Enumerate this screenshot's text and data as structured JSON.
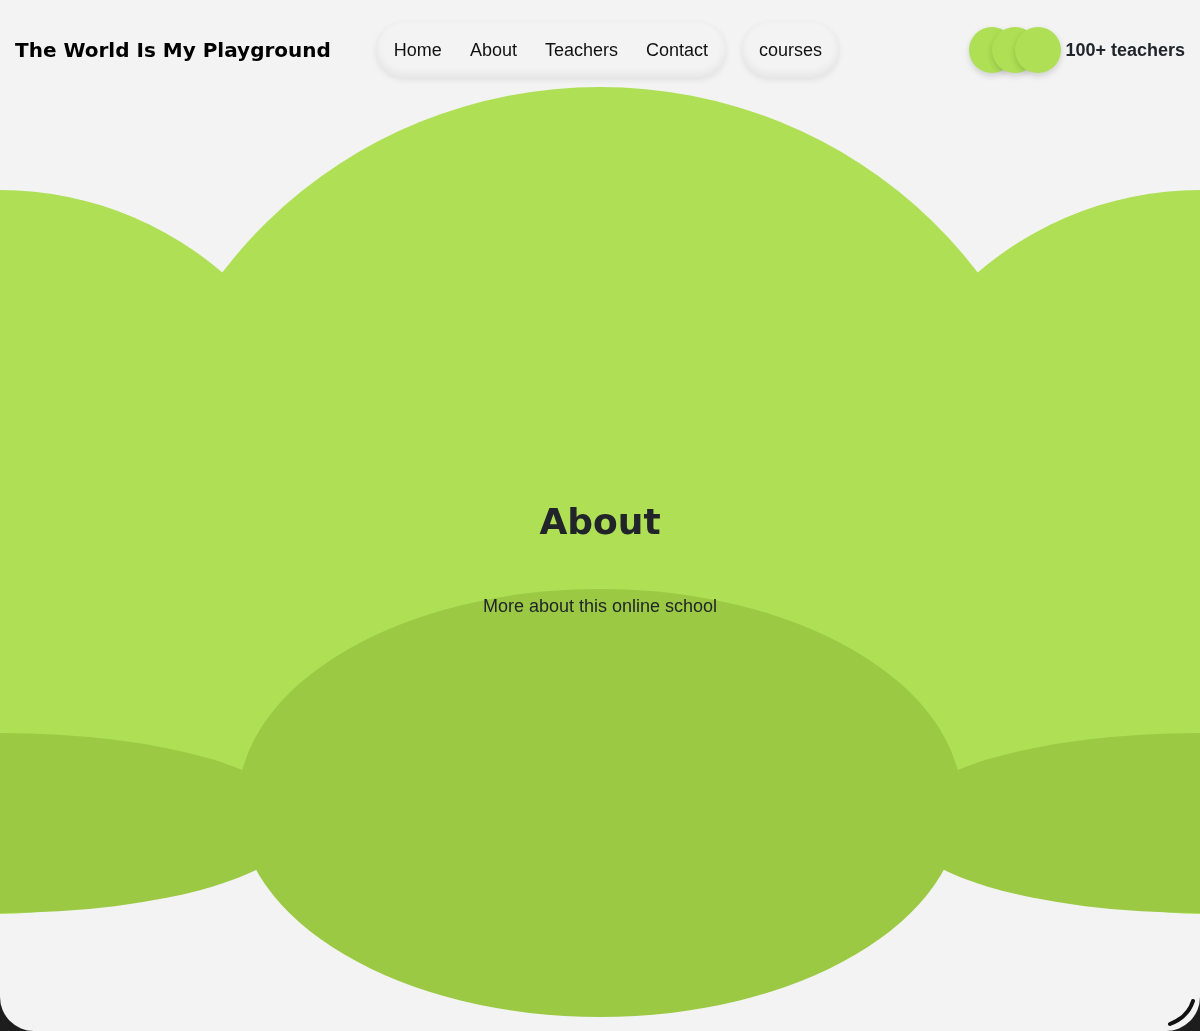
{
  "brand": "The World Is My Playground",
  "nav": {
    "links": [
      "Home",
      "About",
      "Teachers",
      "Contact"
    ],
    "courses": "courses"
  },
  "teachers": {
    "label": "100+ teachers"
  },
  "hero": {
    "title": "About",
    "subtitle": "More about this online school"
  }
}
